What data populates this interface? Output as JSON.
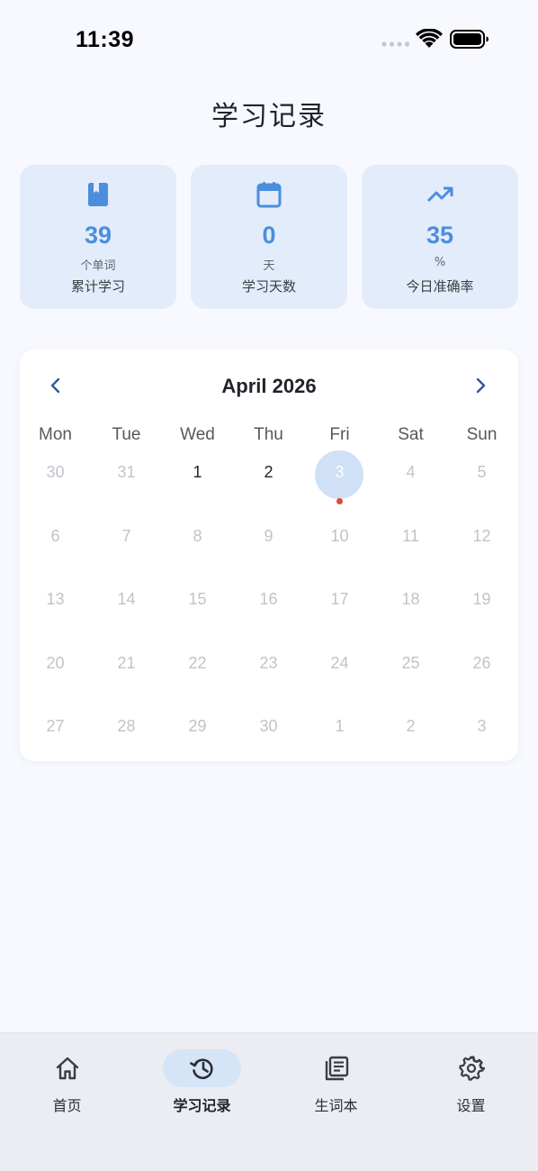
{
  "status_bar": {
    "time": "11:39"
  },
  "header": {
    "title": "学习记录"
  },
  "stats": [
    {
      "icon": "book-icon",
      "value": "39",
      "unit": "个单词",
      "label": "累计学习"
    },
    {
      "icon": "calendar-icon",
      "value": "0",
      "unit": "天",
      "label": "学习天数"
    },
    {
      "icon": "trending-up-icon",
      "value": "35",
      "unit": "%",
      "label": "今日准确率"
    }
  ],
  "calendar": {
    "month_label": "April 2026",
    "weekdays": [
      "Mon",
      "Tue",
      "Wed",
      "Thu",
      "Fri",
      "Sat",
      "Sun"
    ],
    "days": [
      [
        "30",
        "31",
        "1",
        "2",
        "3",
        "4",
        "5"
      ],
      [
        "6",
        "7",
        "8",
        "9",
        "10",
        "11",
        "12"
      ],
      [
        "13",
        "14",
        "15",
        "16",
        "17",
        "18",
        "19"
      ],
      [
        "20",
        "21",
        "22",
        "23",
        "24",
        "25",
        "26"
      ],
      [
        "27",
        "28",
        "29",
        "30",
        "1",
        "2",
        "3"
      ]
    ],
    "today": "3"
  },
  "nav": [
    {
      "icon": "home-icon",
      "label": "首页",
      "active": false
    },
    {
      "icon": "history-icon",
      "label": "学习记录",
      "active": true
    },
    {
      "icon": "wordbook-icon",
      "label": "生词本",
      "active": false
    },
    {
      "icon": "settings-gear-icon",
      "label": "设置",
      "active": false
    }
  ],
  "colors": {
    "accent": "#4a8edc",
    "card_bg": "#e3ecfb",
    "today_circle": "#cfe0f7",
    "today_dot": "#e04a3a",
    "nav_active_pill": "#d6e4f7"
  }
}
